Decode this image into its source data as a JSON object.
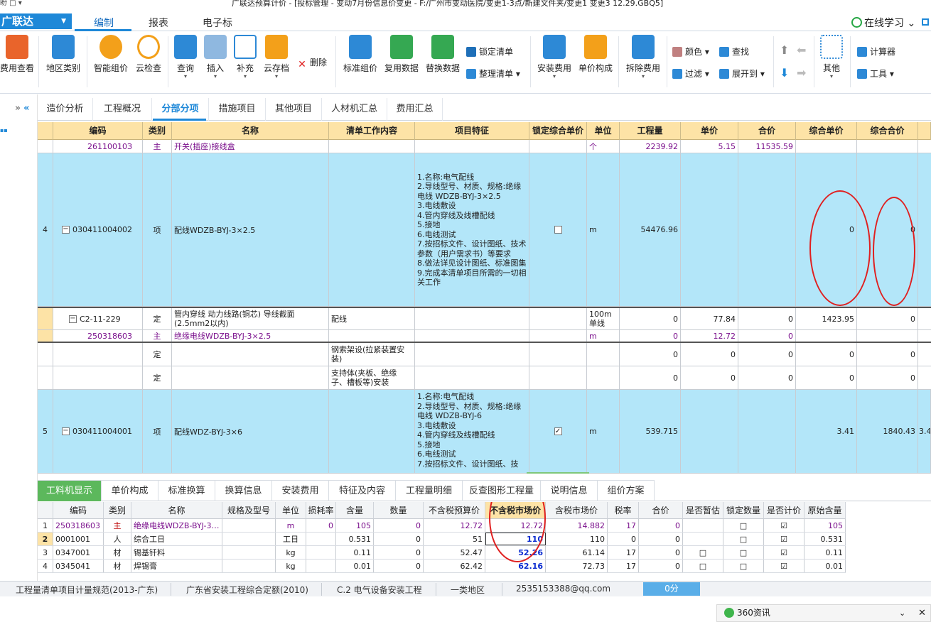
{
  "window": {
    "quick_access": "盼 □ ▾",
    "title": "广联达预算计价 - [投标管理 - 变动7月份信息价变更 - F:/广州市变动医院/变更1-3点/新建文件夹/变更1 变更3 12.29.GBQ5]"
  },
  "menubar": {
    "logo": "广联达",
    "logo_arrow": "▼",
    "items": [
      "编制",
      "报表",
      "电子标"
    ],
    "online": "在线学习",
    "online_arrow": "⌄"
  },
  "ribbon": {
    "buttons": [
      {
        "label": "费用查看",
        "color": "#e9642b"
      },
      {
        "label": "地区类别",
        "color": "#2d89d6"
      },
      {
        "label": "智能组价",
        "color": "#f3a01a"
      },
      {
        "label": "云检查",
        "color": "#f3a01a"
      },
      {
        "label": "查询",
        "color": "#2d89d6"
      },
      {
        "label": "插入",
        "color": "#2d89d6"
      },
      {
        "label": "补充",
        "color": "#2d89d6"
      },
      {
        "label": "云存档",
        "color": "#f3a01a"
      },
      {
        "label": "标准组价",
        "color": "#2d89d6"
      },
      {
        "label": "复用数据",
        "color": "#35a852"
      },
      {
        "label": "替换数据",
        "color": "#35a852"
      },
      {
        "label": "安装费用",
        "color": "#2d89d6"
      },
      {
        "label": "单价构成",
        "color": "#f3a01a"
      },
      {
        "label": "拆除费用",
        "color": "#2d89d6"
      },
      {
        "label": "其他",
        "color": "#2d89d6"
      }
    ],
    "small": {
      "delete": "删除",
      "lock_list": "锁定清单",
      "tidy_list": "整理清单",
      "color": "颜色",
      "find": "查找",
      "filter": "过滤",
      "expand": "展开到",
      "calculator": "计算器",
      "tools": "工具"
    }
  },
  "tabs": [
    "造价分析",
    "工程概况",
    "分部分项",
    "措施项目",
    "其他项目",
    "人材机汇总",
    "费用汇总"
  ],
  "grid": {
    "headers": [
      "编码",
      "类别",
      "名称",
      "清单工作内容",
      "项目特征",
      "锁定综合单价",
      "单位",
      "工程量",
      "单价",
      "合价",
      "综合单价",
      "综合合价"
    ],
    "rows": [
      {
        "no": "",
        "code": "26110010З",
        "type": "主",
        "name": "开关(插座)接线盒",
        "content": "",
        "feature": "",
        "locked": "",
        "unit": "个",
        "qty": "2239.92",
        "price": "5.15",
        "total": "11535.59",
        "cprice": "",
        "ctotal": ""
      },
      {
        "no": "4",
        "code": "030411004002",
        "type": "项",
        "name": "配线WDZB-BYJ-3×2.5",
        "content": "",
        "feature": "1.名称:电气配线\n2.导线型号、材质、规格:绝缘电线 WDZB-BYJ-3×2.5\n3.电线敷设\n4.管内穿线及线槽配线\n5.接地\n6.电线测试\n7.按招标文件、设计图纸、技术参数（用户需求书）等要求\n8.做法详见设计图纸、标准图集\n9.完成本清单项目所需的一切相关工作",
        "locked": "□",
        "unit": "m",
        "qty": "54476.96",
        "price": "",
        "total": "",
        "cprice": "0",
        "ctotal": "0"
      },
      {
        "no": "",
        "code": "C2-11-229",
        "type": "定",
        "name": "管内穿线 动力线路(铜芯) 导线截面(2.5mm2以内)",
        "content": "配线",
        "feature": "",
        "locked": "",
        "unit": "100m单线",
        "qty": "0",
        "price": "77.84",
        "total": "0",
        "cprice": "1423.95",
        "ctotal": "0"
      },
      {
        "no": "",
        "code": "250318603",
        "type": "主",
        "name": "绝缘电线WDZB-BYJ-3×2.5",
        "content": "",
        "feature": "",
        "locked": "",
        "unit": "m",
        "qty": "0",
        "price": "12.72",
        "total": "0",
        "cprice": "",
        "ctotal": ""
      },
      {
        "no": "",
        "code": "",
        "type": "定",
        "name": "",
        "content": "钢索架设(拉紧装置安装)",
        "feature": "",
        "locked": "",
        "unit": "",
        "qty": "0",
        "price": "0",
        "total": "0",
        "cprice": "0",
        "ctotal": "0"
      },
      {
        "no": "",
        "code": "",
        "type": "定",
        "name": "",
        "content": "支持体(夹板、绝缘子、槽板等)安装",
        "feature": "",
        "locked": "",
        "unit": "",
        "qty": "0",
        "price": "0",
        "total": "0",
        "cprice": "0",
        "ctotal": "0"
      },
      {
        "no": "5",
        "code": "030411004001",
        "type": "项",
        "name": "配线WDZ-BYJ-3×6",
        "content": "",
        "feature": "1.名称:电气配线\n2.导线型号、材质、规格:绝缘电线 WDZB-BYJ-6\n3.电线敷设\n4.管内穿线及线槽配线\n5.接地\n6.电线测试\n7.按招标文件、设计图纸、技",
        "locked": "☑",
        "unit": "m",
        "qty": "539.715",
        "price": "",
        "total": "",
        "cprice": "3.41",
        "ctotal": "1840.43",
        "extra": "3.4"
      }
    ]
  },
  "bottom_tabs": [
    "工料机显示",
    "单价构成",
    "标准换算",
    "换算信息",
    "安装费用",
    "特征及内容",
    "工程量明细",
    "反查图形工程量",
    "说明信息",
    "组价方案"
  ],
  "bottom_grid": {
    "headers": [
      "编码",
      "类别",
      "名称",
      "规格及型号",
      "单位",
      "损耗率",
      "含量",
      "数量",
      "不含税预算价",
      "不含税市场价",
      "含税市场价",
      "税率",
      "合价",
      "是否暂估",
      "锁定数量",
      "是否计价",
      "原始含量"
    ],
    "rows": [
      {
        "no": "1",
        "code": "250318603",
        "type": "主",
        "name": "绝缘电线WDZB-BYJ-3…",
        "spec": "",
        "unit": "m",
        "loss": "0",
        "content": "105",
        "qty": "0",
        "budget": "12.72",
        "market": "12.72",
        "taxmarket": "14.882",
        "tax": "17",
        "total": "0",
        "est": "",
        "lockq": "□",
        "priced": "☑",
        "orig": "105"
      },
      {
        "no": "2",
        "code": "0001001",
        "type": "人",
        "name": "综合工日",
        "spec": "",
        "unit": "工日",
        "loss": "",
        "content": "0.531",
        "qty": "0",
        "budget": "51",
        "market": "110",
        "taxmarket": "110",
        "tax": "0",
        "total": "0",
        "est": "",
        "lockq": "□",
        "priced": "☑",
        "orig": "0.531"
      },
      {
        "no": "3",
        "code": "0347001",
        "type": "材",
        "name": "锡基钎料",
        "spec": "",
        "unit": "kg",
        "loss": "",
        "content": "0.11",
        "qty": "0",
        "budget": "52.47",
        "market": "52.26",
        "taxmarket": "61.14",
        "tax": "17",
        "total": "0",
        "est": "□",
        "lockq": "□",
        "priced": "☑",
        "orig": "0.11"
      },
      {
        "no": "4",
        "code": "0345041",
        "type": "材",
        "name": "焊锡膏",
        "spec": "",
        "unit": "kg",
        "loss": "",
        "content": "0.01",
        "qty": "0",
        "budget": "62.42",
        "market": "62.16",
        "taxmarket": "72.73",
        "tax": "17",
        "total": "0",
        "est": "□",
        "lockq": "□",
        "priced": "☑",
        "orig": "0.01"
      }
    ]
  },
  "status": {
    "items": [
      "工程量清单项目计量规范(2013-广东)",
      "广东省安装工程综合定额(2010)",
      "C.2 电气设备安装工程",
      "一类地区",
      "2535153388@qq.com"
    ],
    "score": "0分"
  },
  "news": {
    "label": "360资讯",
    "arrow": "⌄",
    "close": "✕"
  }
}
